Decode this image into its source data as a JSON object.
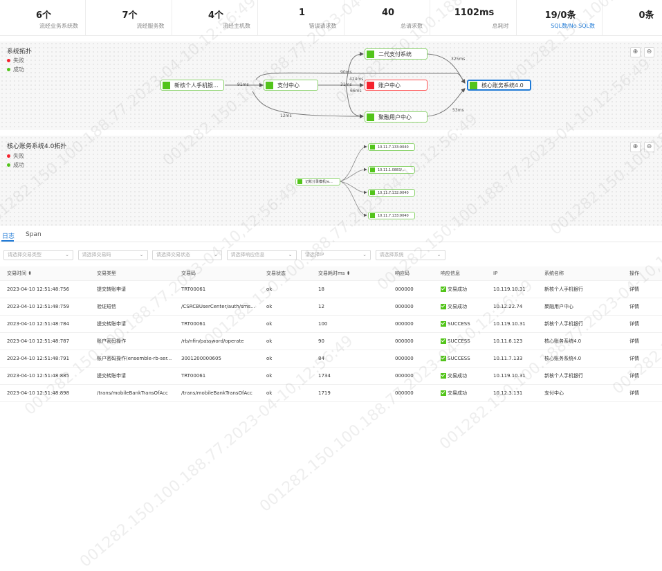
{
  "stats": [
    {
      "value": "6个",
      "label": "流经业务系统数",
      "link": false
    },
    {
      "value": "7个",
      "label": "流经服务数",
      "link": false
    },
    {
      "value": "4个",
      "label": "流经主机数",
      "link": false
    },
    {
      "value": "1",
      "label": "错误请求数",
      "link": false
    },
    {
      "value": "40",
      "label": "总请求数",
      "link": false
    },
    {
      "value": "1102ms",
      "label": "总耗时",
      "link": false
    },
    {
      "value": "19/0条",
      "label": "SQL数/No SQL数",
      "link": true
    },
    {
      "value": "0条",
      "label": "长耗时",
      "link": false
    }
  ],
  "topo1": {
    "title": "系统拓扑",
    "legend_fail": "失败",
    "legend_success": "成功",
    "nodes": {
      "n1": "新核个人手机银...",
      "n2": "支付中心",
      "n3": "二代支付系统",
      "n4": "账户中心",
      "n5": "聚融用户中心",
      "n6": "核心账务系统4.0"
    },
    "edges": {
      "e1": "91ms",
      "e2": "90ms",
      "e3": "424ms",
      "e4": "31ms",
      "e5": "66ms",
      "e6": "12ms",
      "e7": "325ms",
      "e8": "53ms"
    }
  },
  "topo2": {
    "title": "核心账务系统4.0拓扑",
    "legend_fail": "失败",
    "legend_success": "成功",
    "nodes": {
      "src": "记账分录模机(e...",
      "t1": "10.11.7.133:9040",
      "t2": "10.11.1.0883/...",
      "t3": "10.11.7.132:9040",
      "t4": "10.11.7.133:9040"
    }
  },
  "zoom": {
    "in_icon": "zoom-in-icon",
    "out_icon": "zoom-out-icon"
  },
  "tabs": [
    "日志",
    "Span"
  ],
  "filters": [
    "请选择交易类型",
    "请选择交易码",
    "请选择交易状态",
    "请选择响应信息",
    "请选择IP",
    "请选择系统"
  ],
  "table": {
    "headers": [
      "交易时间 ⬍",
      "交易类型",
      "交易码",
      "交易状态",
      "交易耗时ms ⬍",
      "响应码",
      "响应信息",
      "IP",
      "系统名称",
      "操作"
    ],
    "rows": [
      [
        "2023-04-10 12:51:48:756",
        "提交转账申请",
        "TRT00061",
        "ok",
        "18",
        "000000",
        "交易成功",
        "10.119.10.31",
        "新核个人手机银行",
        "详情"
      ],
      [
        "2023-04-10 12:51:48:759",
        "验证短信",
        "/CSRCBUserCenter/auth/sms...",
        "ok",
        "12",
        "000000",
        "交易成功",
        "10.12.22.74",
        "聚融用户中心",
        "详情"
      ],
      [
        "2023-04-10 12:51:48:784",
        "提交转账申请",
        "TRT00061",
        "ok",
        "100",
        "000000",
        "SUCCESS",
        "10.119.10.31",
        "新核个人手机银行",
        "详情"
      ],
      [
        "2023-04-10 12:51:48:787",
        "账户密码操作",
        "/rb/nfin/password/operate",
        "ok",
        "90",
        "000000",
        "SUCCESS",
        "10.11.6.123",
        "核心账务系统4.0",
        "详情"
      ],
      [
        "2023-04-10 12:51:48:791",
        "账户密码操作(ensemble-rb-ser...",
        "3001200000605",
        "ok",
        "84",
        "000000",
        "SUCCESS",
        "10.11.7.133",
        "核心账务系统4.0",
        "详情"
      ],
      [
        "2023-04-10 12:51:48:885",
        "提交转账申请",
        "TRT00061",
        "ok",
        "1734",
        "000000",
        "交易成功",
        "10.119.10.31",
        "新核个人手机银行",
        "详情"
      ],
      [
        "2023-04-10 12:51:48:898",
        "/trans/mobileBankTransOfAcc",
        "/trans/mobileBankTransOfAcc",
        "ok",
        "1719",
        "000000",
        "交易成功",
        "10.12.3.131",
        "支付中心",
        "详情"
      ]
    ]
  },
  "watermark": "001282.150.100.188.77.2023-04-10,12:56:49"
}
